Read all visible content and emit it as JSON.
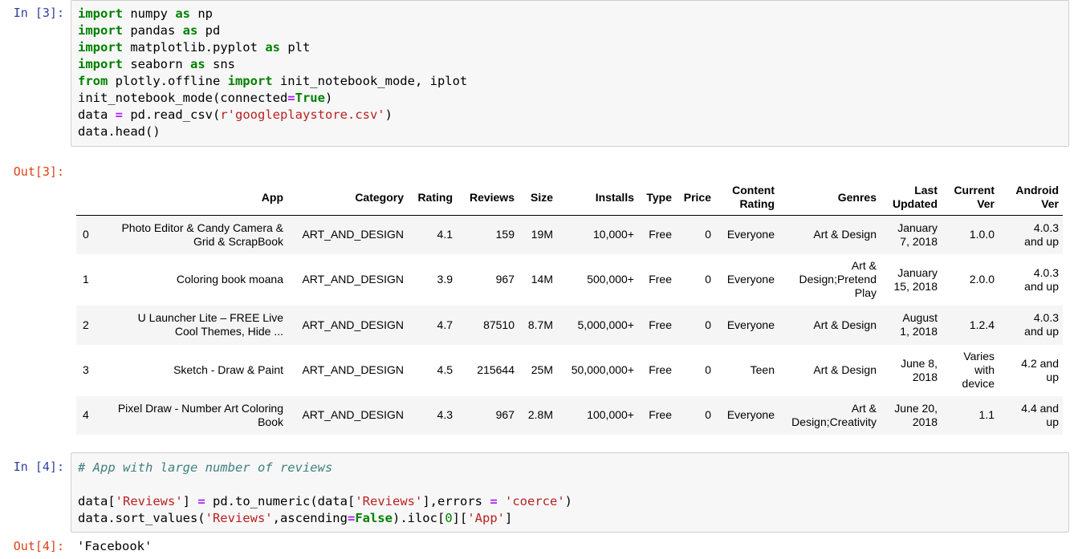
{
  "cell3": {
    "in_prompt": "In [3]:",
    "out_prompt": "Out[3]:",
    "code": [
      [
        {
          "t": "import",
          "c": "k"
        },
        {
          "t": " numpy ",
          "c": ""
        },
        {
          "t": "as",
          "c": "k"
        },
        {
          "t": " np",
          "c": ""
        }
      ],
      [
        {
          "t": "import",
          "c": "k"
        },
        {
          "t": " pandas ",
          "c": ""
        },
        {
          "t": "as",
          "c": "k"
        },
        {
          "t": " pd",
          "c": ""
        }
      ],
      [
        {
          "t": "import",
          "c": "k"
        },
        {
          "t": " matplotlib.pyplot ",
          "c": ""
        },
        {
          "t": "as",
          "c": "k"
        },
        {
          "t": " plt",
          "c": ""
        }
      ],
      [
        {
          "t": "import",
          "c": "k"
        },
        {
          "t": " seaborn ",
          "c": ""
        },
        {
          "t": "as",
          "c": "k"
        },
        {
          "t": " sns",
          "c": ""
        }
      ],
      [
        {
          "t": "from",
          "c": "k"
        },
        {
          "t": " plotly.offline ",
          "c": ""
        },
        {
          "t": "import",
          "c": "k"
        },
        {
          "t": " init_notebook_mode, iplot",
          "c": ""
        }
      ],
      [
        {
          "t": "init_notebook_mode(connected",
          "c": ""
        },
        {
          "t": "=",
          "c": "o"
        },
        {
          "t": "True",
          "c": "k"
        },
        {
          "t": ")",
          "c": ""
        }
      ],
      [
        {
          "t": "data ",
          "c": ""
        },
        {
          "t": "=",
          "c": "o"
        },
        {
          "t": " pd.read_csv(",
          "c": ""
        },
        {
          "t": "r'googleplaystore.csv'",
          "c": "s"
        },
        {
          "t": ")",
          "c": ""
        }
      ],
      [
        {
          "t": "data.head()",
          "c": ""
        }
      ]
    ],
    "table": {
      "headers": [
        {
          "lines": [
            ""
          ]
        },
        {
          "lines": [
            "App"
          ]
        },
        {
          "lines": [
            "Category"
          ]
        },
        {
          "lines": [
            "Rating"
          ]
        },
        {
          "lines": [
            "Reviews"
          ]
        },
        {
          "lines": [
            "Size"
          ]
        },
        {
          "lines": [
            "Installs"
          ]
        },
        {
          "lines": [
            "Type"
          ]
        },
        {
          "lines": [
            "Price"
          ]
        },
        {
          "lines": [
            "Content",
            "Rating"
          ]
        },
        {
          "lines": [
            "Genres"
          ]
        },
        {
          "lines": [
            "Last",
            "Updated"
          ]
        },
        {
          "lines": [
            "Current",
            "Ver"
          ]
        },
        {
          "lines": [
            "Android",
            "Ver"
          ]
        }
      ],
      "rows": [
        [
          [
            "0"
          ],
          [
            "Photo Editor & Candy Camera &",
            "Grid & ScrapBook"
          ],
          [
            "ART_AND_DESIGN"
          ],
          [
            "4.1"
          ],
          [
            "159"
          ],
          [
            "19M"
          ],
          [
            "10,000+"
          ],
          [
            "Free"
          ],
          [
            "0"
          ],
          [
            "Everyone"
          ],
          [
            "Art & Design"
          ],
          [
            "January",
            "7, 2018"
          ],
          [
            "1.0.0"
          ],
          [
            "4.0.3",
            "and up"
          ]
        ],
        [
          [
            "1"
          ],
          [
            "Coloring book moana"
          ],
          [
            "ART_AND_DESIGN"
          ],
          [
            "3.9"
          ],
          [
            "967"
          ],
          [
            "14M"
          ],
          [
            "500,000+"
          ],
          [
            "Free"
          ],
          [
            "0"
          ],
          [
            "Everyone"
          ],
          [
            "Art &",
            "Design;Pretend",
            "Play"
          ],
          [
            "January",
            "15, 2018"
          ],
          [
            "2.0.0"
          ],
          [
            "4.0.3",
            "and up"
          ]
        ],
        [
          [
            "2"
          ],
          [
            "U Launcher Lite – FREE Live",
            "Cool Themes, Hide ..."
          ],
          [
            "ART_AND_DESIGN"
          ],
          [
            "4.7"
          ],
          [
            "87510"
          ],
          [
            "8.7M"
          ],
          [
            "5,000,000+"
          ],
          [
            "Free"
          ],
          [
            "0"
          ],
          [
            "Everyone"
          ],
          [
            "Art & Design"
          ],
          [
            "August",
            "1, 2018"
          ],
          [
            "1.2.4"
          ],
          [
            "4.0.3",
            "and up"
          ]
        ],
        [
          [
            "3"
          ],
          [
            "Sketch - Draw & Paint"
          ],
          [
            "ART_AND_DESIGN"
          ],
          [
            "4.5"
          ],
          [
            "215644"
          ],
          [
            "25M"
          ],
          [
            "50,000,000+"
          ],
          [
            "Free"
          ],
          [
            "0"
          ],
          [
            "Teen"
          ],
          [
            "Art & Design"
          ],
          [
            "June 8,",
            "2018"
          ],
          [
            "Varies",
            "with",
            "device"
          ],
          [
            "4.2 and",
            "up"
          ]
        ],
        [
          [
            "4"
          ],
          [
            "Pixel Draw - Number Art Coloring",
            "Book"
          ],
          [
            "ART_AND_DESIGN"
          ],
          [
            "4.3"
          ],
          [
            "967"
          ],
          [
            "2.8M"
          ],
          [
            "100,000+"
          ],
          [
            "Free"
          ],
          [
            "0"
          ],
          [
            "Everyone"
          ],
          [
            "Art &",
            "Design;Creativity"
          ],
          [
            "June 20,",
            "2018"
          ],
          [
            "1.1"
          ],
          [
            "4.4 and",
            "up"
          ]
        ]
      ]
    }
  },
  "cell4": {
    "in_prompt": "In [4]:",
    "out_prompt": "Out[4]:",
    "code": [
      [
        {
          "t": "# App with large number of reviews",
          "c": "c"
        }
      ],
      [
        {
          "t": "",
          "c": ""
        }
      ],
      [
        {
          "t": "data[",
          "c": ""
        },
        {
          "t": "'Reviews'",
          "c": "s"
        },
        {
          "t": "] ",
          "c": ""
        },
        {
          "t": "=",
          "c": "o"
        },
        {
          "t": " pd.to_numeric(data[",
          "c": ""
        },
        {
          "t": "'Reviews'",
          "c": "s"
        },
        {
          "t": "],errors ",
          "c": ""
        },
        {
          "t": "=",
          "c": "o"
        },
        {
          "t": " ",
          "c": ""
        },
        {
          "t": "'coerce'",
          "c": "s"
        },
        {
          "t": ")",
          "c": ""
        }
      ],
      [
        {
          "t": "data.sort_values(",
          "c": ""
        },
        {
          "t": "'Reviews'",
          "c": "s"
        },
        {
          "t": ",ascending",
          "c": ""
        },
        {
          "t": "=",
          "c": "o"
        },
        {
          "t": "False",
          "c": "k"
        },
        {
          "t": ").iloc[",
          "c": ""
        },
        {
          "t": "0",
          "c": "n"
        },
        {
          "t": "][",
          "c": ""
        },
        {
          "t": "'App'",
          "c": "s"
        },
        {
          "t": "]",
          "c": ""
        }
      ]
    ],
    "output": "'Facebook'"
  }
}
